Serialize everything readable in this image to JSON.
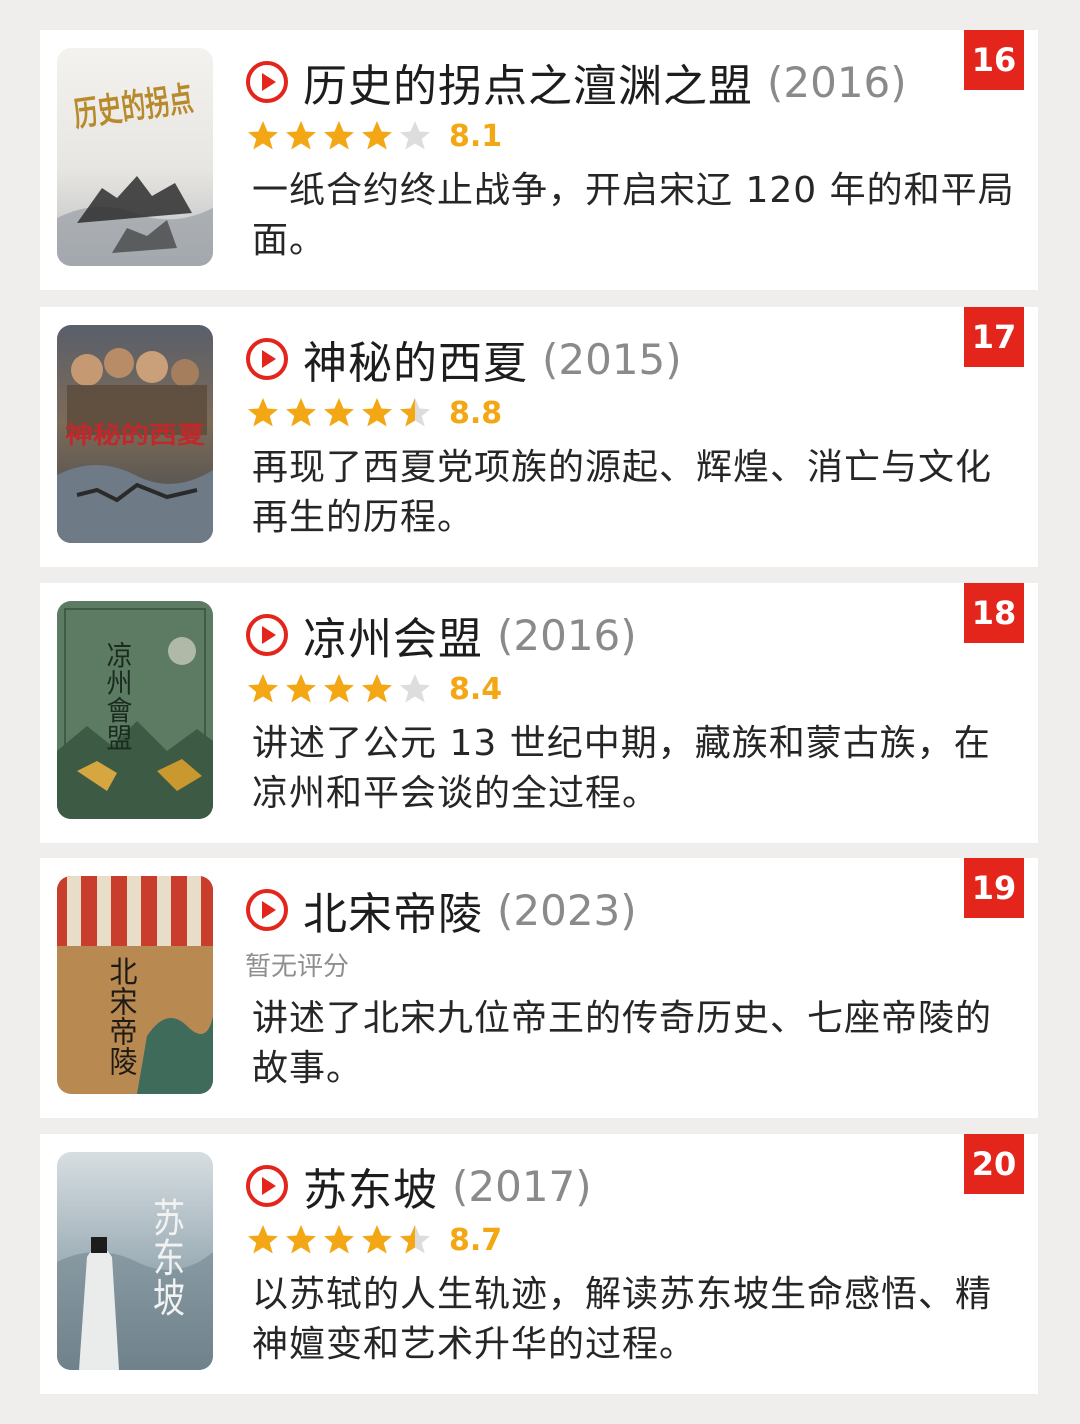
{
  "colors": {
    "background": "#efeeed",
    "card": "#ffffff",
    "accent_red": "#e4251c",
    "star_gold": "#f3a714",
    "star_empty": "#dddddd",
    "year_gray": "#8a8a8a"
  },
  "items": [
    {
      "rank": "16",
      "title": "历史的拐点之澶渊之盟",
      "year": "(2016)",
      "stars": 4,
      "score": "8.1",
      "description": "一纸合约终止战争，开启宋辽 120 年的和平局面。",
      "poster_calligraphy": "历史的拐点",
      "play_icon": "play-circle-icon"
    },
    {
      "rank": "17",
      "title": "神秘的西夏",
      "year": "(2015)",
      "stars": 4.5,
      "score": "8.8",
      "description": "再现了西夏党项族的源起、辉煌、消亡与文化再生的历程。",
      "poster_calligraphy": "神秘的西夏",
      "play_icon": "play-circle-icon"
    },
    {
      "rank": "18",
      "title": "凉州会盟",
      "year": "(2016)",
      "stars": 4,
      "score": "8.4",
      "description": "讲述了公元 13 世纪中期，藏族和蒙古族，在凉州和平会谈的全过程。",
      "poster_calligraphy": "凉州會盟",
      "play_icon": "play-circle-icon"
    },
    {
      "rank": "19",
      "title": "北宋帝陵",
      "year": "(2023)",
      "rating_text": "暂无评分",
      "description": "讲述了北宋九位帝王的传奇历史、七座帝陵的故事。",
      "poster_calligraphy": "北宋帝陵",
      "play_icon": "play-circle-icon"
    },
    {
      "rank": "20",
      "title": "苏东坡",
      "year": "(2017)",
      "stars": 4.5,
      "score": "8.7",
      "description": "以苏轼的人生轨迹，解读苏东坡生命感悟、精神嬗变和艺术升华的过程。",
      "poster_calligraphy": "苏东坡",
      "play_icon": "play-circle-icon"
    }
  ]
}
